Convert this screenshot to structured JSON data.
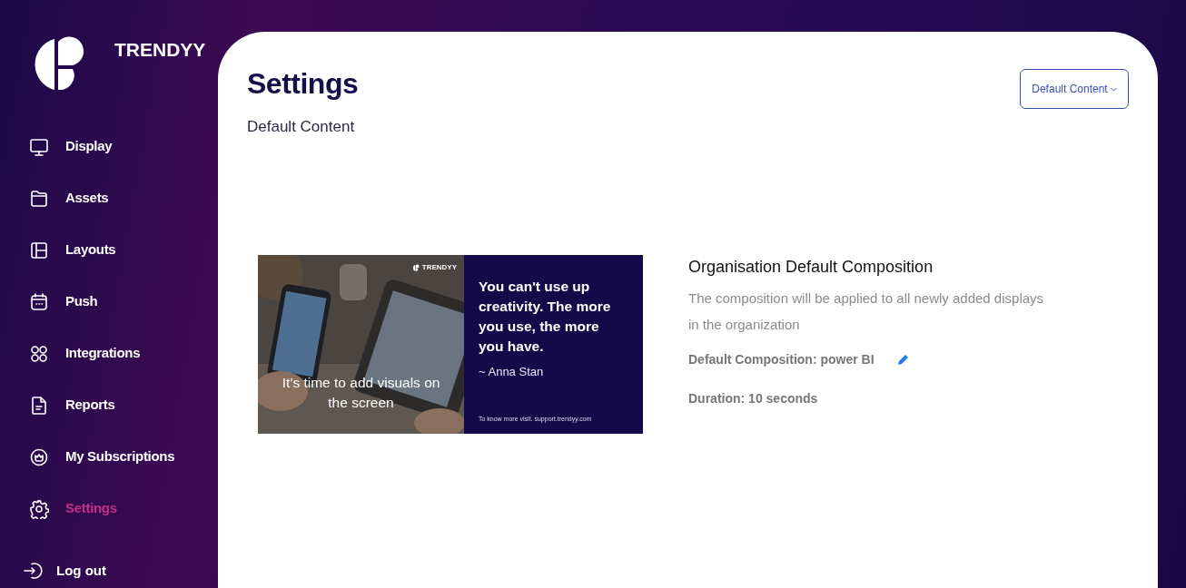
{
  "brand": "TRENDYY",
  "nav": [
    {
      "label": "Display",
      "selected": false
    },
    {
      "label": "Assets",
      "selected": false
    },
    {
      "label": "Layouts",
      "selected": false
    },
    {
      "label": "Push",
      "selected": false
    },
    {
      "label": "Integrations",
      "selected": false
    },
    {
      "label": "Reports",
      "selected": false
    },
    {
      "label": "My Subscriptions",
      "selected": false
    },
    {
      "label": "Settings",
      "selected": true
    }
  ],
  "logout": "Log out",
  "page": {
    "title": "Settings",
    "subtitle": "Default Content",
    "dropdown": "Default Content"
  },
  "preview": {
    "brand": "TRENDYY",
    "caption": "It’s time to add visuals on the screen",
    "quote": "You can't use up creativity. The more you use, the more you have.",
    "author": "~ Anna Stan",
    "footer": "To know more visit. support.trendyy.com"
  },
  "composition": {
    "title": "Organisation Default Composition",
    "description": "The composition will be applied to all newly added displays in the organization",
    "default": "Default Composition: power BI",
    "duration": "Duration: 10 seconds"
  }
}
